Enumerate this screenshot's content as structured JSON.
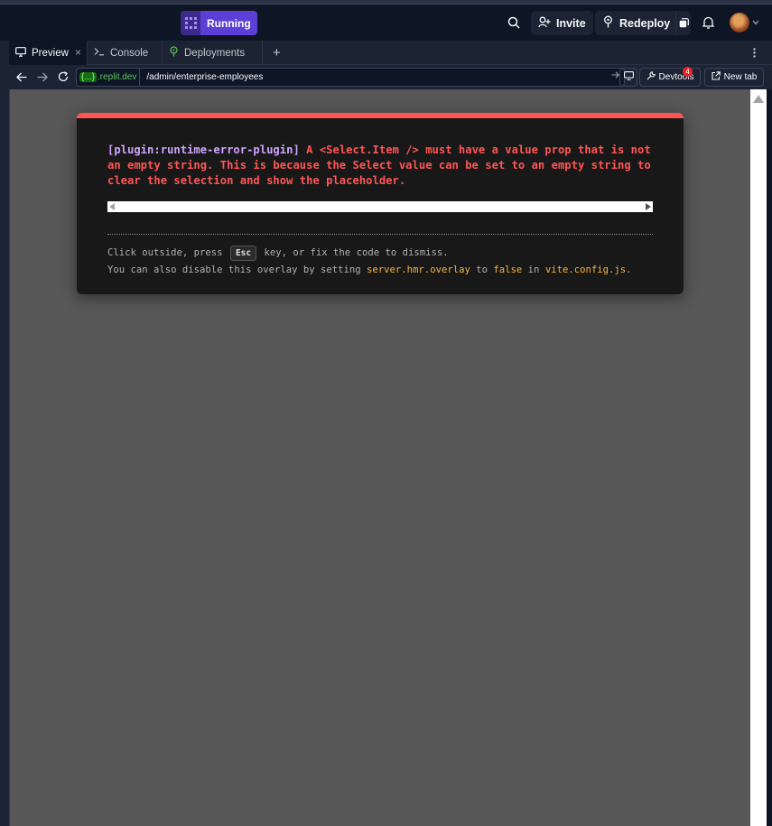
{
  "header": {
    "run_status": "Running",
    "invite_label": "Invite",
    "redeploy_label": "Redeploy"
  },
  "tabs": [
    {
      "label": "Preview",
      "icon": "monitor-icon",
      "active": true
    },
    {
      "label": "Console",
      "icon": "terminal-icon",
      "active": false
    },
    {
      "label": "Deployments",
      "icon": "deploy-icon",
      "active": false
    }
  ],
  "tab_close_glyph": "×",
  "tab_add_glyph": "+",
  "urlbar": {
    "domain_brace": "{...}",
    "domain_suffix": ".replit.dev",
    "path": "/admin/enterprise-employees",
    "devtools_label": "Devtools",
    "devtools_badge": "4",
    "new_tab_label": "New tab"
  },
  "error_overlay": {
    "plugin": "[plugin:runtime-error-plugin]",
    "message": "A <Select.Item /> must have a value prop that is not an empty string. This is because the Select value can be set to an empty string to clear the selection and show the placeholder.",
    "tip_line1_before": "Click outside, press",
    "tip_key": "Esc",
    "tip_line1_after": "key, or fix the code to dismiss.",
    "tip_line2_before": "You can also disable this overlay by setting",
    "tip_code1": "server.hmr.overlay",
    "tip_line2_mid1": "to",
    "tip_code2": "false",
    "tip_line2_mid2": "in",
    "tip_code3": "vite.config.js",
    "tip_line2_end": "."
  },
  "colors": {
    "running_accent": "#5b3fd6",
    "error_accent": "#ff5555",
    "code_accent": "#f9b53a",
    "plugin_accent": "#cfa4ff"
  }
}
